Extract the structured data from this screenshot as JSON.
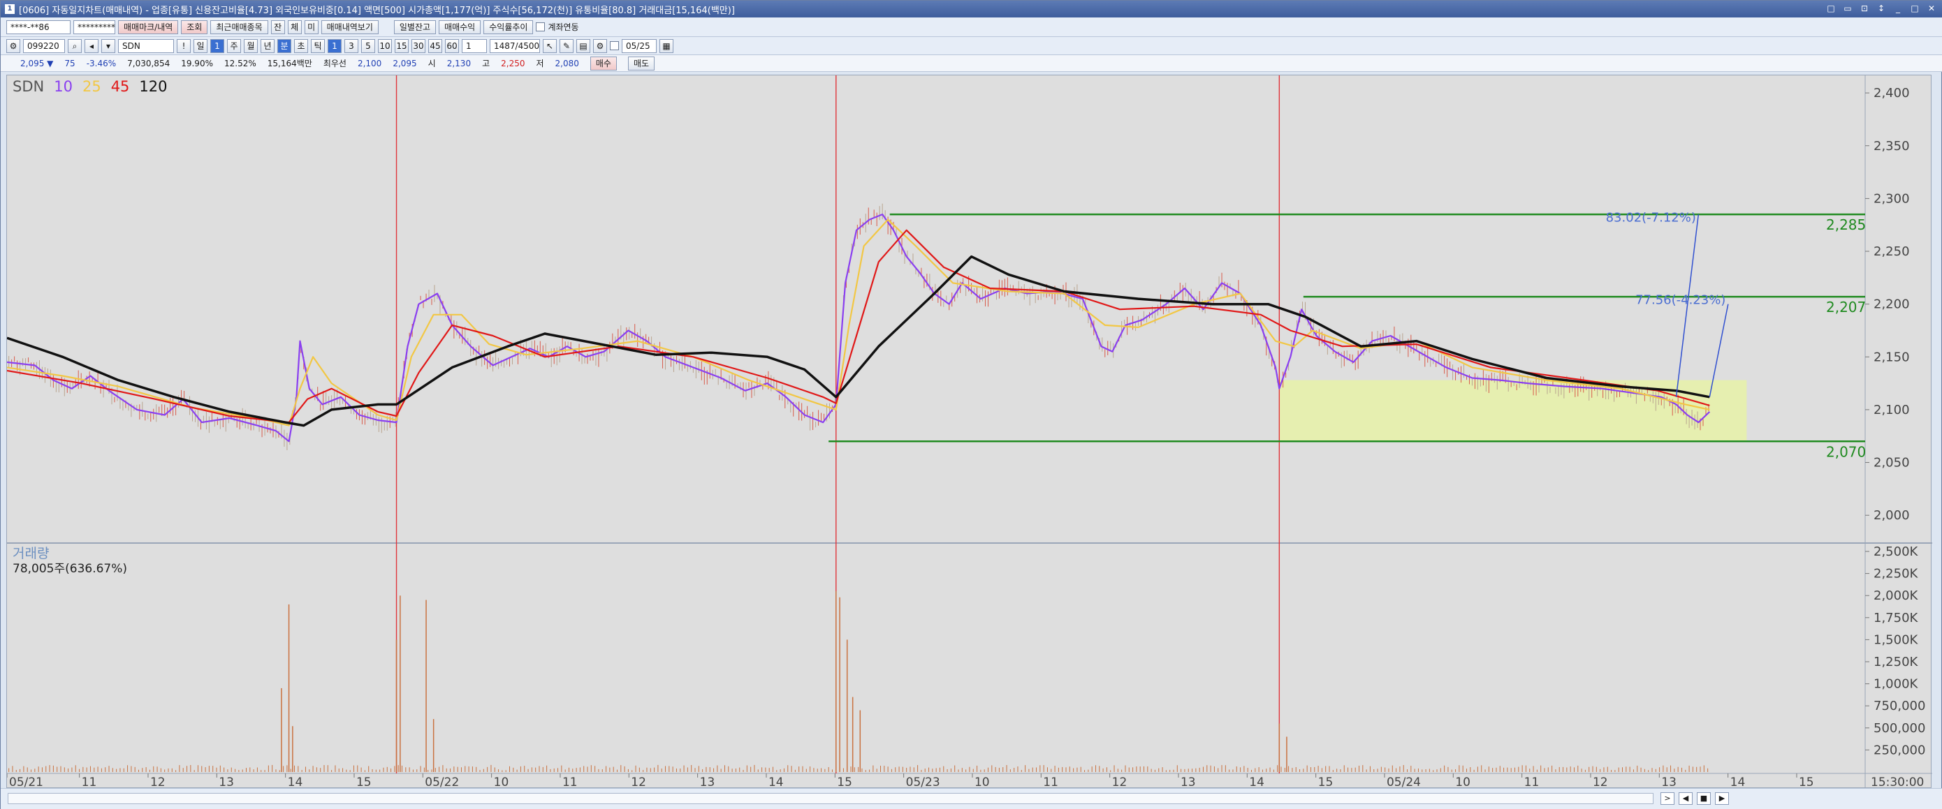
{
  "window": {
    "title_icon": "1",
    "title": "[0606] 자동일지차트(매매내역) - 업종[유통] 신용잔고비율[4.73] 외국인보유비중[0.14] 액면[500] 시가총액[1,177(억)] 주식수[56,172(천)] 유통비율[80.8] 거래대금[15,164(백만)]"
  },
  "toolbar1": {
    "account": "****-**86",
    "password": "*********",
    "tab_mark": "매매마크/내역",
    "query": "조회",
    "recent": "최근매매종목",
    "b_gan": "잔",
    "b_che": "체",
    "b_mi": "미",
    "view_history": "매매내역보기",
    "daily_balance": "일별잔고",
    "trade_profit": "매매수익",
    "profit_trend": "수익률추이",
    "link_label": "계좌연동"
  },
  "toolbar2": {
    "code": "099220",
    "name": "SDN",
    "period_buttons": [
      "일",
      "1",
      "주",
      "월",
      "년",
      "분",
      "초",
      "틱"
    ],
    "minute_buttons": [
      "1",
      "3",
      "5",
      "10",
      "15",
      "30",
      "45",
      "60"
    ],
    "count_sel": "1",
    "range": "1487/4500",
    "date_value": "05/25"
  },
  "inforow": {
    "price": "2,095 ▼",
    "change": "75",
    "change_pct": "-3.46%",
    "volume": "7,030,854",
    "v1": "19.90%",
    "v2": "12.52%",
    "amount": "15,164백만",
    "best_label": "최우선",
    "best1": "2,100",
    "best2": "2,095",
    "open_label": "시",
    "open": "2,130",
    "high_label": "고",
    "high": "2,250",
    "low_label": "저",
    "low": "2,080",
    "buy_btn": "매수",
    "sell_btn": "매도"
  },
  "legend": {
    "name": "SDN",
    "ma": [
      {
        "label": "10",
        "color": "#8a3ff0"
      },
      {
        "label": "25",
        "color": "#f2c744"
      },
      {
        "label": "45",
        "color": "#e01818"
      },
      {
        "label": "120",
        "color": "#111111"
      }
    ]
  },
  "volume_panel": {
    "title": "거래량",
    "sub": "78,005주(636.67%)"
  },
  "chart_data": {
    "type": "line",
    "price_axis_ticks": [
      "2,400",
      "2,350",
      "2,300",
      "2,250",
      "2,200",
      "2,150",
      "2,100",
      "2,050",
      "2,000"
    ],
    "price_ylim": [
      1975,
      2410
    ],
    "volume_axis_ticks": [
      "2,500K",
      "2,250K",
      "2,000K",
      "1,750K",
      "1,500K",
      "1,250K",
      "1,000K",
      "750,000",
      "500,000",
      "250,000"
    ],
    "volume_ylim": [
      0,
      2500000
    ],
    "x_ticks": [
      "05/21",
      "11",
      "12",
      "13",
      "14",
      "15",
      "05/22",
      "10",
      "11",
      "12",
      "13",
      "14",
      "15",
      "05/23",
      "10",
      "11",
      "12",
      "13",
      "14",
      "15",
      "05/24",
      "10",
      "11",
      "12",
      "13",
      "14",
      "15"
    ],
    "x_end_label": "15:30:00",
    "x_range": [
      0,
      1000
    ],
    "day_dividers": [
      210,
      447,
      686
    ],
    "series": [
      {
        "key": "ma10",
        "color": "#8a3ff0",
        "points": [
          [
            0,
            2145
          ],
          [
            15,
            2142
          ],
          [
            25,
            2128
          ],
          [
            35,
            2120
          ],
          [
            45,
            2132
          ],
          [
            55,
            2118
          ],
          [
            70,
            2100
          ],
          [
            85,
            2095
          ],
          [
            95,
            2110
          ],
          [
            105,
            2088
          ],
          [
            120,
            2092
          ],
          [
            135,
            2085
          ],
          [
            145,
            2080
          ],
          [
            152,
            2070
          ],
          [
            156,
            2110
          ],
          [
            158,
            2165
          ],
          [
            163,
            2120
          ],
          [
            170,
            2105
          ],
          [
            180,
            2112
          ],
          [
            190,
            2095
          ],
          [
            200,
            2090
          ],
          [
            210,
            2088
          ],
          [
            216,
            2160
          ],
          [
            222,
            2200
          ],
          [
            232,
            2210
          ],
          [
            240,
            2180
          ],
          [
            250,
            2160
          ],
          [
            262,
            2142
          ],
          [
            272,
            2150
          ],
          [
            282,
            2158
          ],
          [
            292,
            2150
          ],
          [
            302,
            2160
          ],
          [
            312,
            2150
          ],
          [
            322,
            2155
          ],
          [
            335,
            2175
          ],
          [
            345,
            2165
          ],
          [
            355,
            2150
          ],
          [
            370,
            2140
          ],
          [
            385,
            2130
          ],
          [
            398,
            2118
          ],
          [
            410,
            2125
          ],
          [
            420,
            2112
          ],
          [
            430,
            2095
          ],
          [
            440,
            2088
          ],
          [
            447,
            2105
          ],
          [
            452,
            2220
          ],
          [
            458,
            2270
          ],
          [
            465,
            2280
          ],
          [
            472,
            2285
          ],
          [
            478,
            2270
          ],
          [
            485,
            2245
          ],
          [
            492,
            2230
          ],
          [
            500,
            2210
          ],
          [
            508,
            2200
          ],
          [
            515,
            2220
          ],
          [
            525,
            2205
          ],
          [
            538,
            2215
          ],
          [
            550,
            2210
          ],
          [
            565,
            2212
          ],
          [
            580,
            2205
          ],
          [
            590,
            2160
          ],
          [
            596,
            2155
          ],
          [
            603,
            2180
          ],
          [
            612,
            2185
          ],
          [
            625,
            2200
          ],
          [
            635,
            2215
          ],
          [
            645,
            2195
          ],
          [
            655,
            2220
          ],
          [
            665,
            2210
          ],
          [
            676,
            2180
          ],
          [
            684,
            2140
          ],
          [
            686,
            2120
          ],
          [
            692,
            2150
          ],
          [
            698,
            2195
          ],
          [
            706,
            2170
          ],
          [
            716,
            2155
          ],
          [
            726,
            2145
          ],
          [
            736,
            2165
          ],
          [
            746,
            2170
          ],
          [
            756,
            2160
          ],
          [
            766,
            2150
          ],
          [
            776,
            2140
          ],
          [
            790,
            2130
          ],
          [
            805,
            2128
          ],
          [
            820,
            2125
          ],
          [
            840,
            2122
          ],
          [
            860,
            2120
          ],
          [
            880,
            2115
          ],
          [
            892,
            2112
          ],
          [
            900,
            2105
          ],
          [
            906,
            2095
          ],
          [
            912,
            2088
          ],
          [
            918,
            2098
          ]
        ]
      },
      {
        "key": "ma25",
        "color": "#f2c744",
        "points": [
          [
            0,
            2140
          ],
          [
            30,
            2132
          ],
          [
            60,
            2122
          ],
          [
            100,
            2102
          ],
          [
            140,
            2090
          ],
          [
            152,
            2085
          ],
          [
            158,
            2120
          ],
          [
            165,
            2150
          ],
          [
            175,
            2125
          ],
          [
            200,
            2095
          ],
          [
            210,
            2090
          ],
          [
            218,
            2150
          ],
          [
            230,
            2190
          ],
          [
            245,
            2190
          ],
          [
            260,
            2162
          ],
          [
            280,
            2152
          ],
          [
            310,
            2158
          ],
          [
            340,
            2165
          ],
          [
            370,
            2150
          ],
          [
            400,
            2128
          ],
          [
            430,
            2110
          ],
          [
            447,
            2100
          ],
          [
            454,
            2180
          ],
          [
            462,
            2255
          ],
          [
            475,
            2280
          ],
          [
            490,
            2255
          ],
          [
            510,
            2220
          ],
          [
            540,
            2212
          ],
          [
            570,
            2210
          ],
          [
            592,
            2180
          ],
          [
            610,
            2178
          ],
          [
            640,
            2200
          ],
          [
            665,
            2210
          ],
          [
            684,
            2165
          ],
          [
            694,
            2160
          ],
          [
            704,
            2175
          ],
          [
            730,
            2158
          ],
          [
            760,
            2165
          ],
          [
            790,
            2140
          ],
          [
            830,
            2128
          ],
          [
            870,
            2120
          ],
          [
            905,
            2105
          ],
          [
            918,
            2100
          ]
        ]
      },
      {
        "key": "ma45",
        "color": "#e01818",
        "points": [
          [
            0,
            2137
          ],
          [
            40,
            2125
          ],
          [
            80,
            2110
          ],
          [
            120,
            2094
          ],
          [
            152,
            2088
          ],
          [
            162,
            2110
          ],
          [
            175,
            2120
          ],
          [
            200,
            2098
          ],
          [
            210,
            2094
          ],
          [
            222,
            2135
          ],
          [
            240,
            2180
          ],
          [
            262,
            2170
          ],
          [
            290,
            2150
          ],
          [
            330,
            2160
          ],
          [
            370,
            2150
          ],
          [
            410,
            2130
          ],
          [
            440,
            2112
          ],
          [
            447,
            2106
          ],
          [
            458,
            2170
          ],
          [
            470,
            2240
          ],
          [
            485,
            2270
          ],
          [
            505,
            2235
          ],
          [
            530,
            2215
          ],
          [
            570,
            2212
          ],
          [
            600,
            2195
          ],
          [
            640,
            2198
          ],
          [
            676,
            2190
          ],
          [
            692,
            2175
          ],
          [
            720,
            2160
          ],
          [
            760,
            2162
          ],
          [
            800,
            2140
          ],
          [
            850,
            2128
          ],
          [
            890,
            2118
          ],
          [
            910,
            2108
          ],
          [
            918,
            2104
          ]
        ]
      },
      {
        "key": "ma120",
        "color": "#111111",
        "points": [
          [
            0,
            2168
          ],
          [
            30,
            2150
          ],
          [
            60,
            2128
          ],
          [
            90,
            2112
          ],
          [
            120,
            2098
          ],
          [
            150,
            2088
          ],
          [
            160,
            2085
          ],
          [
            175,
            2100
          ],
          [
            200,
            2105
          ],
          [
            210,
            2105
          ],
          [
            240,
            2140
          ],
          [
            270,
            2160
          ],
          [
            290,
            2172
          ],
          [
            320,
            2162
          ],
          [
            350,
            2152
          ],
          [
            380,
            2154
          ],
          [
            410,
            2150
          ],
          [
            430,
            2138
          ],
          [
            447,
            2112
          ],
          [
            470,
            2160
          ],
          [
            500,
            2210
          ],
          [
            520,
            2245
          ],
          [
            540,
            2228
          ],
          [
            570,
            2212
          ],
          [
            610,
            2205
          ],
          [
            650,
            2200
          ],
          [
            680,
            2200
          ],
          [
            700,
            2188
          ],
          [
            730,
            2160
          ],
          [
            760,
            2165
          ],
          [
            790,
            2148
          ],
          [
            830,
            2130
          ],
          [
            870,
            2122
          ],
          [
            900,
            2118
          ],
          [
            918,
            2112
          ]
        ]
      }
    ],
    "annotations": [
      {
        "type": "hline",
        "value": 2285,
        "x_from": 476,
        "color": "#1f8a1f",
        "label": "2,285"
      },
      {
        "type": "hline",
        "value": 2207,
        "x_from": 699,
        "color": "#1f8a1f",
        "label": "2,207"
      },
      {
        "type": "hline",
        "value": 2070,
        "x_from": 443,
        "color": "#1f8a1f",
        "label": "2,070"
      },
      {
        "type": "box",
        "y_range": [
          2070,
          2128
        ],
        "x_range": [
          686,
          938
        ],
        "color": "#e8f2a8"
      },
      {
        "type": "trend_label",
        "text": "83.02(-7.12%)",
        "x": 862,
        "value": 2278,
        "color": "#4b6ed1"
      },
      {
        "type": "trend_label",
        "text": "77.56(-4.23%)",
        "x": 878,
        "value": 2200,
        "color": "#4b6ed1"
      },
      {
        "type": "trend_line",
        "from": [
          912,
          2285
        ],
        "to": [
          900,
          2112
        ],
        "color": "#3050d0"
      },
      {
        "type": "trend_line",
        "from": [
          928,
          2200
        ],
        "to": [
          918,
          2112
        ],
        "color": "#3050d0"
      }
    ],
    "volume_spikes": [
      [
        148,
        950000
      ],
      [
        152,
        1900000
      ],
      [
        154,
        520000
      ],
      [
        210,
        1500000
      ],
      [
        212,
        2000000
      ],
      [
        226,
        1950000
      ],
      [
        230,
        600000
      ],
      [
        447,
        2050000
      ],
      [
        449,
        1980000
      ],
      [
        453,
        1500000
      ],
      [
        456,
        850000
      ],
      [
        460,
        700000
      ],
      [
        686,
        550000
      ],
      [
        690,
        400000
      ]
    ]
  },
  "statusbar": {
    "scroll_buttons": [
      ">",
      "◀",
      "■",
      "▶"
    ]
  }
}
